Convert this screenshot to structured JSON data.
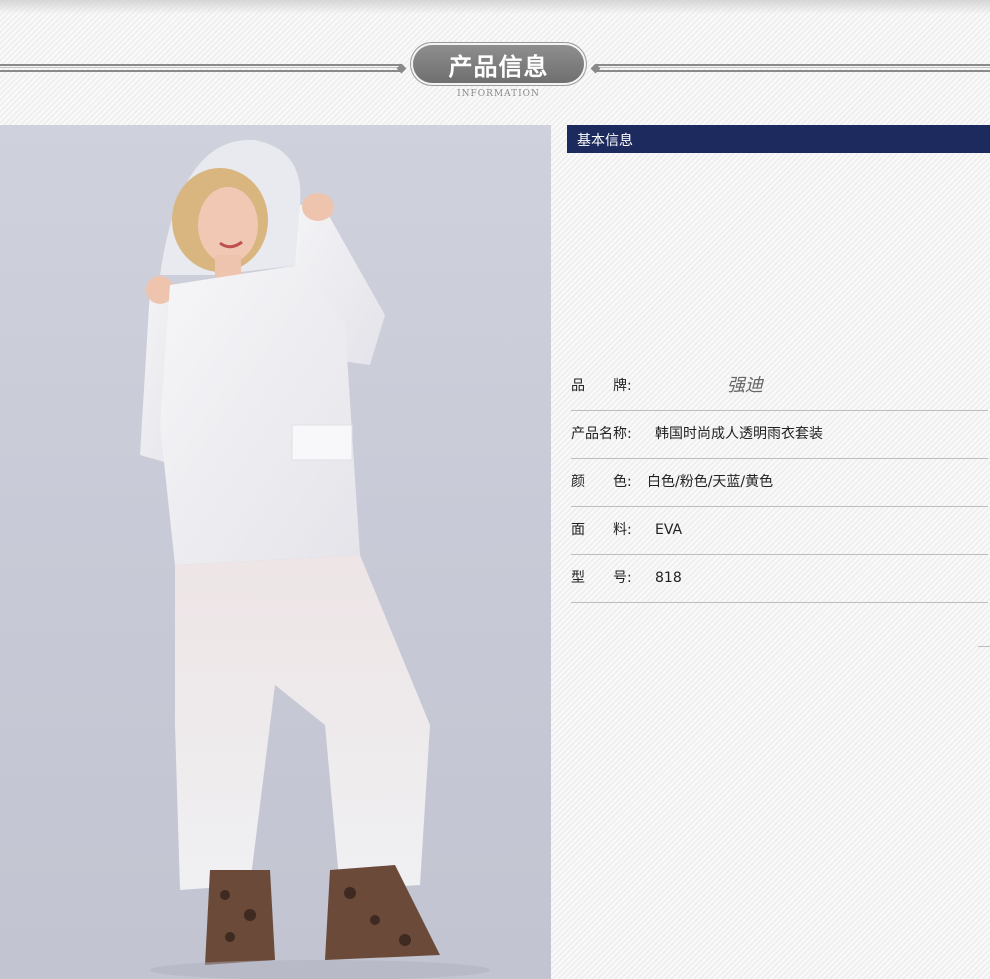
{
  "header": {
    "title": "产品信息",
    "subtitle": "INFORMATION"
  },
  "photo": {
    "subject": "raincoat-model-photo"
  },
  "info": {
    "section_title": "基本信息",
    "rows": [
      {
        "key": "品　　牌:",
        "value": "强迪"
      },
      {
        "key": "产品名称:",
        "value": "韩国时尚成人透明雨衣套装"
      },
      {
        "key": "颜　　色:",
        "value": "白色/粉色/天蓝/黄色"
      },
      {
        "key": "面　　料:",
        "value": "EVA"
      },
      {
        "key": "型　　号:",
        "value": "818"
      }
    ]
  },
  "colors": {
    "section_bar": "#1d2a5e",
    "header_pill": "#7e7e7e",
    "background": "#f4f4f4"
  }
}
